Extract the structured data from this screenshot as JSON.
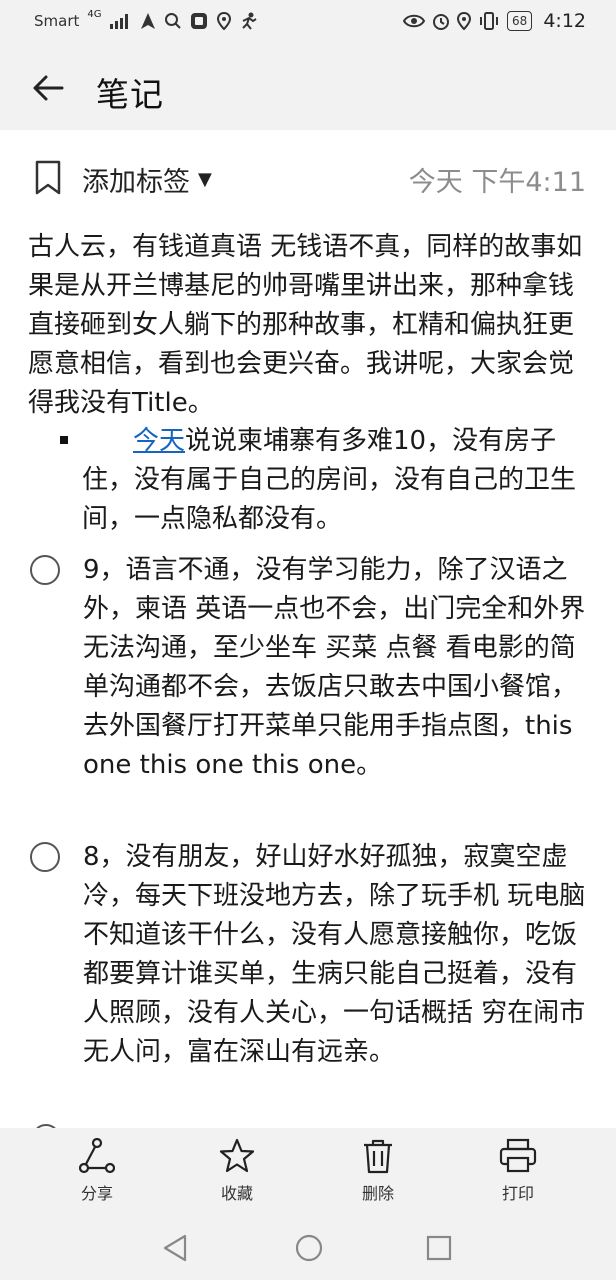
{
  "status_bar": {
    "carrier": "Smart",
    "network": "4G",
    "battery": "68",
    "time": "4:12"
  },
  "header": {
    "title": "笔记"
  },
  "meta": {
    "tag_label": "添加标签",
    "date": "今天 下午4:11"
  },
  "note": {
    "paragraph": "古人云，有钱道真语 无钱语不真，同样的故事如果是从开兰博基尼的帅哥嘴里讲出来，那种拿钱直接砸到女人躺下的那种故事，杠精和偏执狂更愿意相信，看到也会更兴奋。我讲呢，大家会觉得我没有Title。",
    "bullet_link": "今天",
    "bullet_text": "说说柬埔寨有多难10，没有房子住，没有属于自己的房间，没有自己的卫生间，一点隐私都没有。",
    "todos": [
      {
        "text": "9，语言不通，没有学习能力，除了汉语之外，柬语 英语一点也不会，出门完全和外界无法沟通，至少坐车 买菜 点餐 看电影的简单沟通都不会，去饭店只敢去中国小餐馆，去外国餐厅打开菜单只能用手指点图，this one this one this one。"
      },
      {
        "text": "8，没有朋友，好山好水好孤独，寂寞空虚冷，每天下班没地方去，除了玩手机 玩电脑 不知道该干什么，没有人愿意接触你，吃饭都要算计谁买单，生病只能自己挺着，没有人照顾，没有人关心，一句话概括 穷在闹市无人问，富在深山有远亲。"
      }
    ]
  },
  "toolbar": {
    "share": "分享",
    "favorite": "收藏",
    "delete": "删除",
    "print": "打印"
  },
  "colors": {
    "background": "#ffffff",
    "chrome": "#f2f2f2",
    "link": "#1565c0",
    "muted": "#8c8c8c"
  },
  "icons": [
    "back-arrow-icon",
    "bookmark-icon",
    "caret-down-icon",
    "share-icon",
    "star-icon",
    "trash-icon",
    "printer-icon",
    "nav-back-icon",
    "nav-home-icon",
    "nav-recent-icon"
  ]
}
